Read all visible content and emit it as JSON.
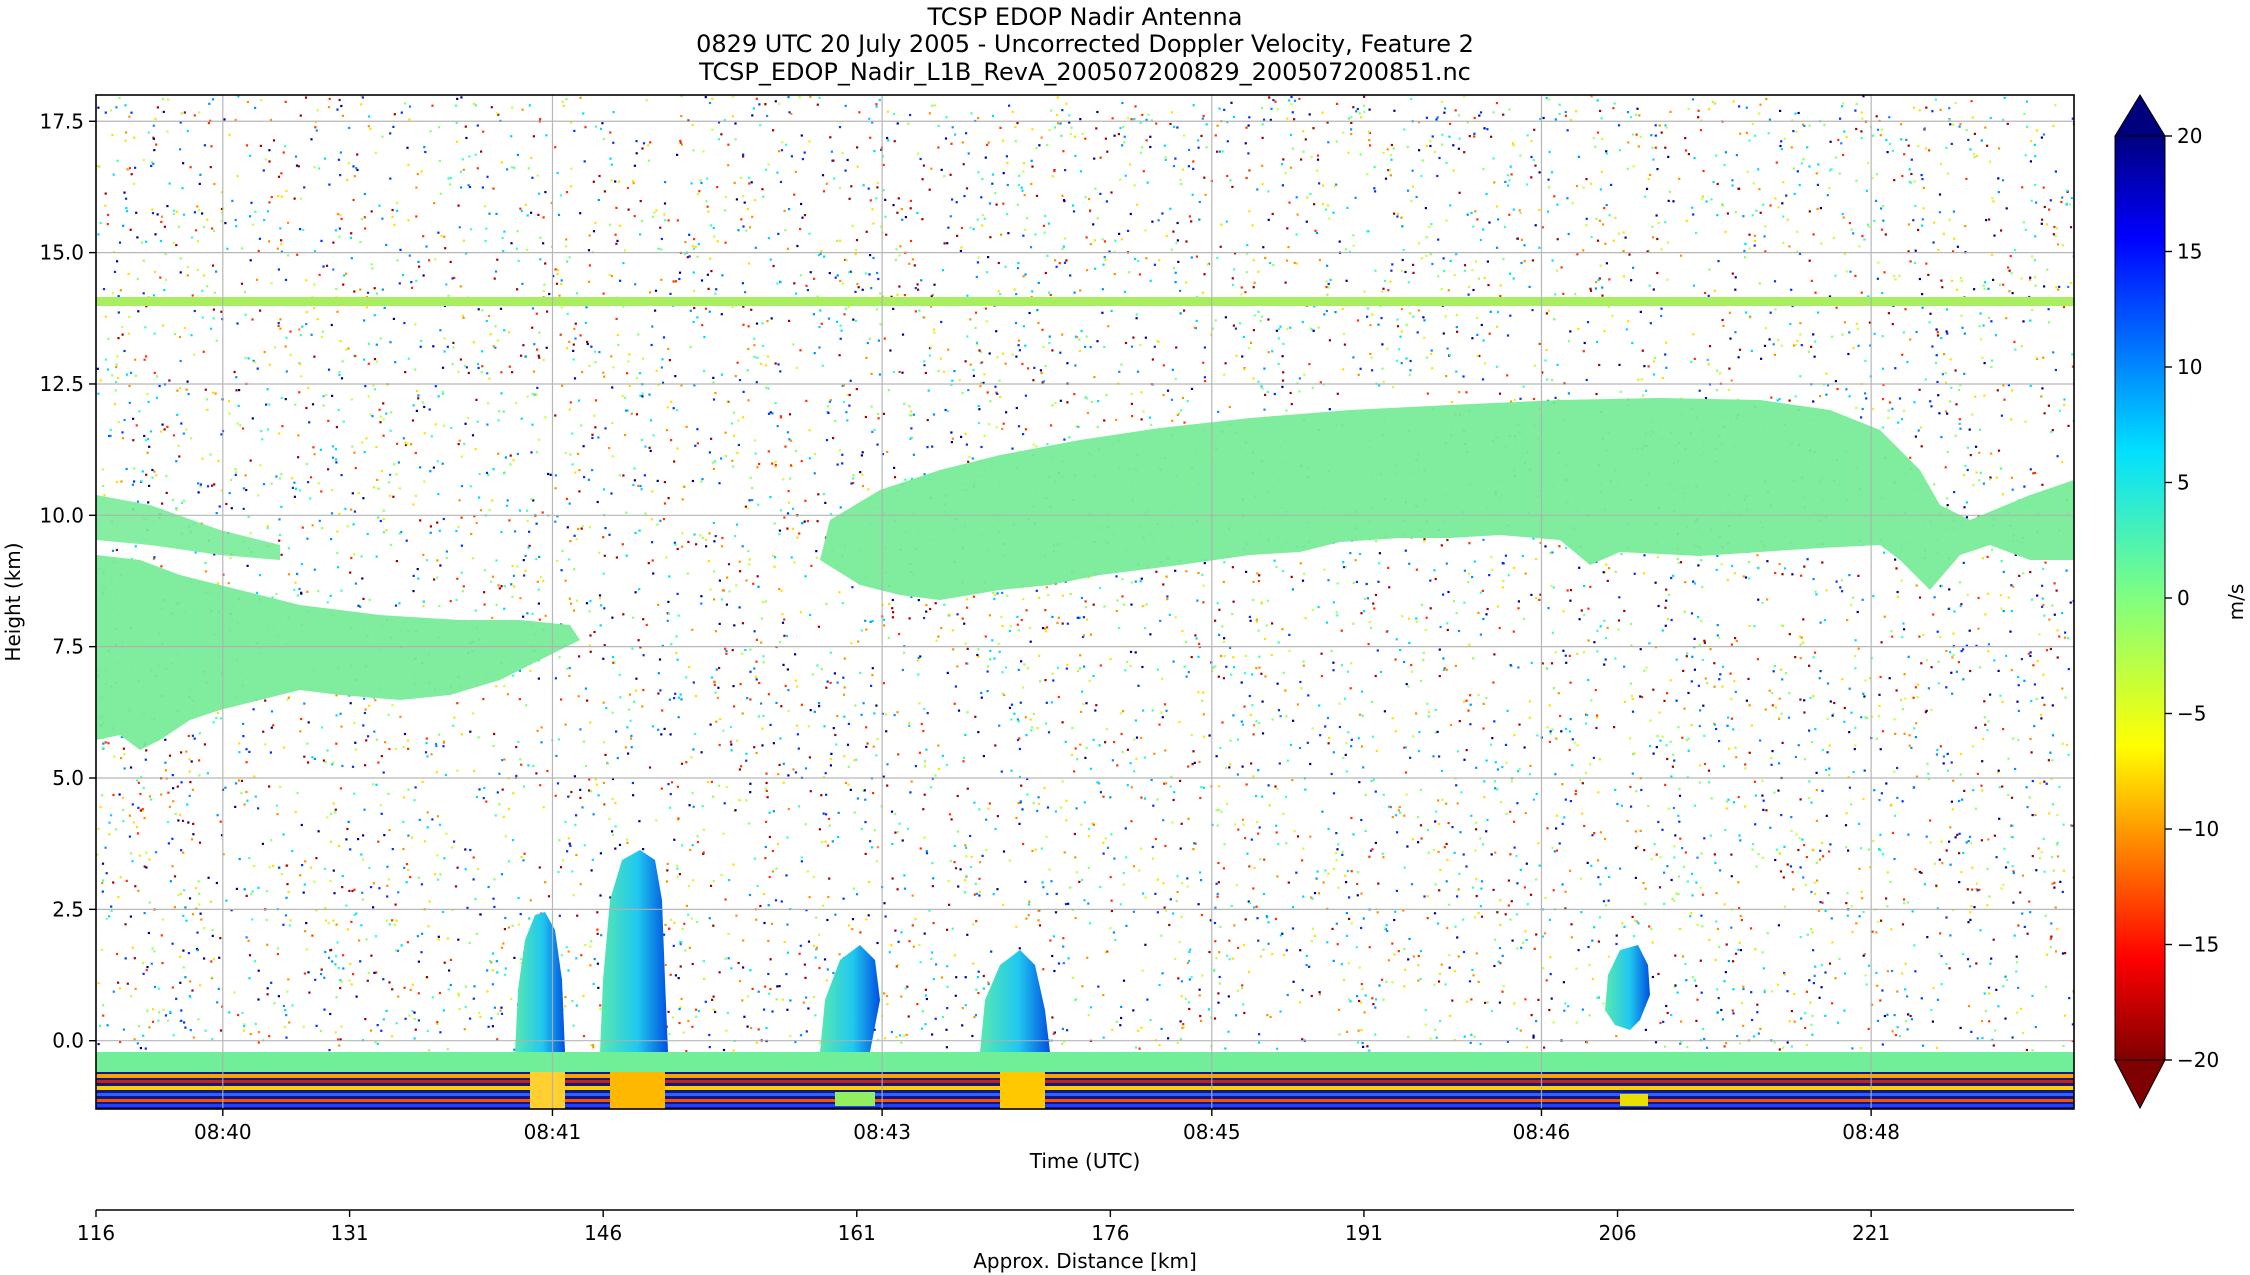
{
  "chart_data": {
    "type": "heatmap",
    "title": [
      "TCSP EDOP Nadir Antenna",
      "0829 UTC 20 July 2005 - Uncorrected Doppler Velocity, Feature 2",
      "TCSP_EDOP_Nadir_L1B_RevA_200507200829_200507200851.nc"
    ],
    "xlabel": "Time (UTC)",
    "ylabel": "Height (km)",
    "x_ticks": [
      "08:40",
      "08:41",
      "08:43",
      "08:45",
      "08:46",
      "08:48"
    ],
    "y_ticks": [
      0.0,
      2.5,
      5.0,
      7.5,
      10.0,
      12.5,
      15.0,
      17.5
    ],
    "y_tick_labels": [
      "0.0",
      "2.5",
      "5.0",
      "7.5",
      "10.0",
      "12.5",
      "15.0",
      "17.5"
    ],
    "ylim": [
      -1.3,
      18.0
    ],
    "grid": true,
    "secondary_x": {
      "label": "Approx. Distance [km]",
      "ticks": [
        116,
        131,
        146,
        161,
        176,
        191,
        206,
        221
      ],
      "range": [
        116,
        233
      ]
    },
    "colorbar": {
      "label": "m/s",
      "range": [
        -20,
        20
      ],
      "ticks": [
        -20,
        -15,
        -10,
        -5,
        0,
        5,
        10,
        15,
        20
      ],
      "tick_labels": [
        "−20",
        "−15",
        "−10",
        "−5",
        "0",
        "5",
        "10",
        "15",
        "20"
      ],
      "colormap": "jet_r",
      "extend": "both"
    },
    "features": [
      {
        "name": "upper cloud layer",
        "x_km": [
          160,
          233
        ],
        "height_km": [
          8.5,
          12.3
        ],
        "velocity_ms": 1
      },
      {
        "name": "mid-level layer",
        "x_km": [
          116,
          145
        ],
        "height_km": [
          5.7,
          9.7
        ],
        "velocity_ms": 1
      },
      {
        "name": "horizontal band",
        "x_km": [
          116,
          233
        ],
        "height_km": [
          14.0,
          14.2
        ],
        "velocity_ms": -1
      },
      {
        "name": "convective cell 1",
        "x_km": [
          141,
          144.5
        ],
        "height_km": [
          0,
          2.6
        ],
        "velocity_ms": 6
      },
      {
        "name": "convective cell 2",
        "x_km": [
          146,
          150.5
        ],
        "height_km": [
          0,
          3.8
        ],
        "velocity_ms": 8
      },
      {
        "name": "convective cell 3",
        "x_km": [
          160,
          164
        ],
        "height_km": [
          0,
          2.0
        ],
        "velocity_ms": 3
      },
      {
        "name": "convective cell 4",
        "x_km": [
          169,
          172.5
        ],
        "height_km": [
          0,
          1.9
        ],
        "velocity_ms": 7
      },
      {
        "name": "convective cell 5",
        "x_km": [
          205,
          208
        ],
        "height_km": [
          0.3,
          2.1
        ],
        "velocity_ms": 4
      },
      {
        "name": "surface layer",
        "x_km": [
          116,
          233
        ],
        "height_km": [
          -0.3,
          0.1
        ],
        "velocity_ms": 2
      }
    ]
  }
}
